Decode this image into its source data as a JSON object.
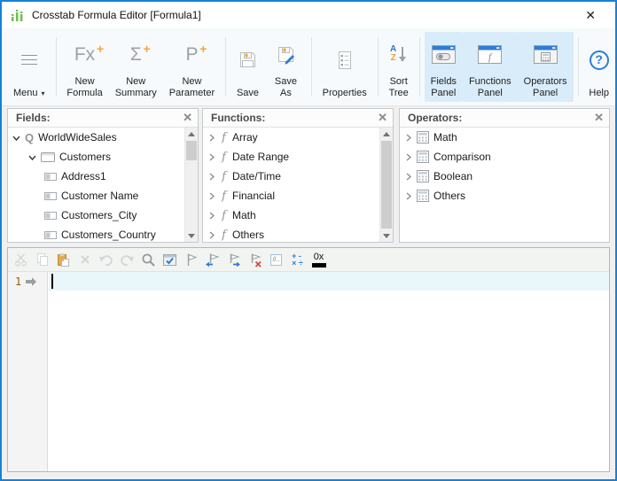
{
  "window": {
    "title": "Crosstab Formula Editor [Formula1]",
    "close_glyph": "✕"
  },
  "toolbar": {
    "menu": {
      "label": "Menu",
      "caret": "▾"
    },
    "new_formula": {
      "glyph": "Fx",
      "plus": "+",
      "line1": "New",
      "line2": "Formula"
    },
    "new_summary": {
      "glyph": "Σ",
      "plus": "+",
      "line1": "New",
      "line2": "Summary"
    },
    "new_parameter": {
      "glyph": "P",
      "plus": "+",
      "line1": "New",
      "line2": "Parameter"
    },
    "save": {
      "label": "Save"
    },
    "save_as": {
      "label": "Save As"
    },
    "properties": {
      "label": "Properties"
    },
    "sort_tree": {
      "letter_a": "A",
      "letter_z": "Z",
      "line1": "Sort",
      "line2": "Tree"
    },
    "fields_panel": {
      "line1": "Fields",
      "line2": "Panel"
    },
    "functions_panel": {
      "line1": "Functions",
      "line2": "Panel"
    },
    "operators_panel": {
      "line1": "Operators",
      "line2": "Panel"
    },
    "help": {
      "glyph": "?",
      "label": "Help"
    }
  },
  "icons": {
    "query_glyph": "Q",
    "function_glyph": "f"
  },
  "panels": {
    "fields": {
      "title": "Fields:",
      "close_glyph": "✕",
      "tree": [
        {
          "label": "WorldWideSales",
          "icon": "query-icon",
          "expanded": true
        },
        {
          "label": "Customers",
          "icon": "table-icon",
          "expanded": true
        },
        {
          "label": "Address1",
          "icon": "field-icon"
        },
        {
          "label": "Customer Name",
          "icon": "field-icon"
        },
        {
          "label": "Customers_City",
          "icon": "field-icon"
        },
        {
          "label": "Customers_Country",
          "icon": "field-icon"
        }
      ]
    },
    "functions": {
      "title": "Functions:",
      "close_glyph": "✕",
      "tree": [
        {
          "label": "Array"
        },
        {
          "label": "Date Range"
        },
        {
          "label": "Date/Time"
        },
        {
          "label": "Financial"
        },
        {
          "label": "Math"
        },
        {
          "label": "Others"
        }
      ]
    },
    "operators": {
      "title": "Operators:",
      "close_glyph": "✕",
      "tree": [
        {
          "label": "Math"
        },
        {
          "label": "Comparison"
        },
        {
          "label": "Boolean"
        },
        {
          "label": "Others"
        }
      ]
    }
  },
  "editor": {
    "toolbar_icons": [
      "cut",
      "copy",
      "paste",
      "delete",
      "undo",
      "redo",
      "find",
      "syntax-check",
      "bookmark",
      "previous-bookmark",
      "next-bookmark",
      "clear-bookmarks",
      "comment",
      "operator-list",
      "hex-view"
    ],
    "comment_glyph": "//..",
    "ops_row1": "+ -",
    "ops_row2": "× ÷",
    "hex_glyph": "0x",
    "line_number": "1",
    "code_text": ""
  },
  "colors": {
    "window_border": "#1581d8",
    "active_toggle_bg": "#d9ecf9",
    "accent_orange": "#f5a73b",
    "accent_blue": "#2e7cd6",
    "current_line_bg": "#e9f7fb",
    "line_number_color": "#9a5c00"
  }
}
